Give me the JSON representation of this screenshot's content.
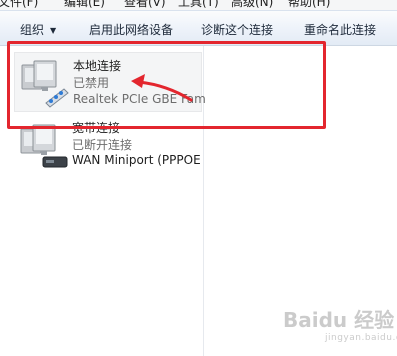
{
  "menu": {
    "items": [
      "文件(F)",
      "编辑(E)",
      "查看(V)",
      "工具(T)",
      "高级(N)",
      "帮助(H)"
    ]
  },
  "toolbar": {
    "organize": "组织",
    "enable": "启用此网络设备",
    "diagnose": "诊断这个连接",
    "rename": "重命名此连接"
  },
  "connections": [
    {
      "name": "本地连接",
      "status": "已禁用",
      "device": "Realtek PCIe GBE Fam",
      "icon": "network-adapter-icon"
    },
    {
      "name": "宽带连接",
      "status": "已断开连接",
      "device": "WAN Miniport (PPPOE",
      "icon": "broadband-connection-icon"
    }
  ],
  "watermark": {
    "text": "Baidu 经验",
    "sub": "jingyan.baidu.com"
  },
  "colors": {
    "highlight": "#e3262e"
  }
}
